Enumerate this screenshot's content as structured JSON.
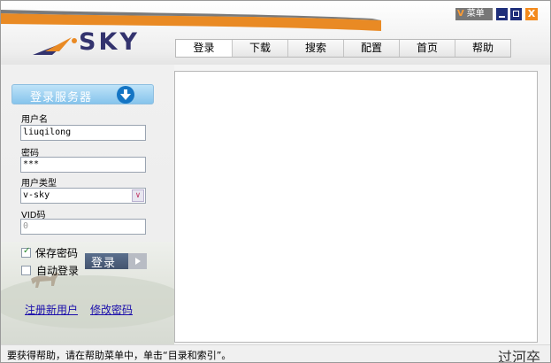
{
  "app": {
    "logo_text": "SKY"
  },
  "window_controls": {
    "menu_prefix": "V",
    "menu_label": "菜单",
    "close_label": "X"
  },
  "tabs": [
    {
      "label": "登录"
    },
    {
      "label": "下载"
    },
    {
      "label": "搜索"
    },
    {
      "label": "配置"
    },
    {
      "label": "首页"
    },
    {
      "label": "帮助"
    }
  ],
  "login": {
    "server_button": "登录服务器",
    "username_label": "用户名",
    "username_value": "liuqilong",
    "password_label": "密码",
    "password_value": "***",
    "user_type_label": "用户类型",
    "user_type_value": "v-sky",
    "vid_label": "VID码",
    "vid_value": "0",
    "save_password_label": "保存密码",
    "save_password_checked": true,
    "auto_login_label": "自动登录",
    "auto_login_checked": false,
    "login_button": "登录"
  },
  "links": {
    "register": "注册新用户",
    "change_password": "修改密码"
  },
  "status": {
    "text": "要获得帮助，请在帮助菜单中，单击“目录和索引”。",
    "watermark": "过河卒"
  },
  "colors": {
    "accent_orange": "#f38a1c",
    "brand_navy": "#33336e",
    "server_btn": "#86c4ec"
  }
}
